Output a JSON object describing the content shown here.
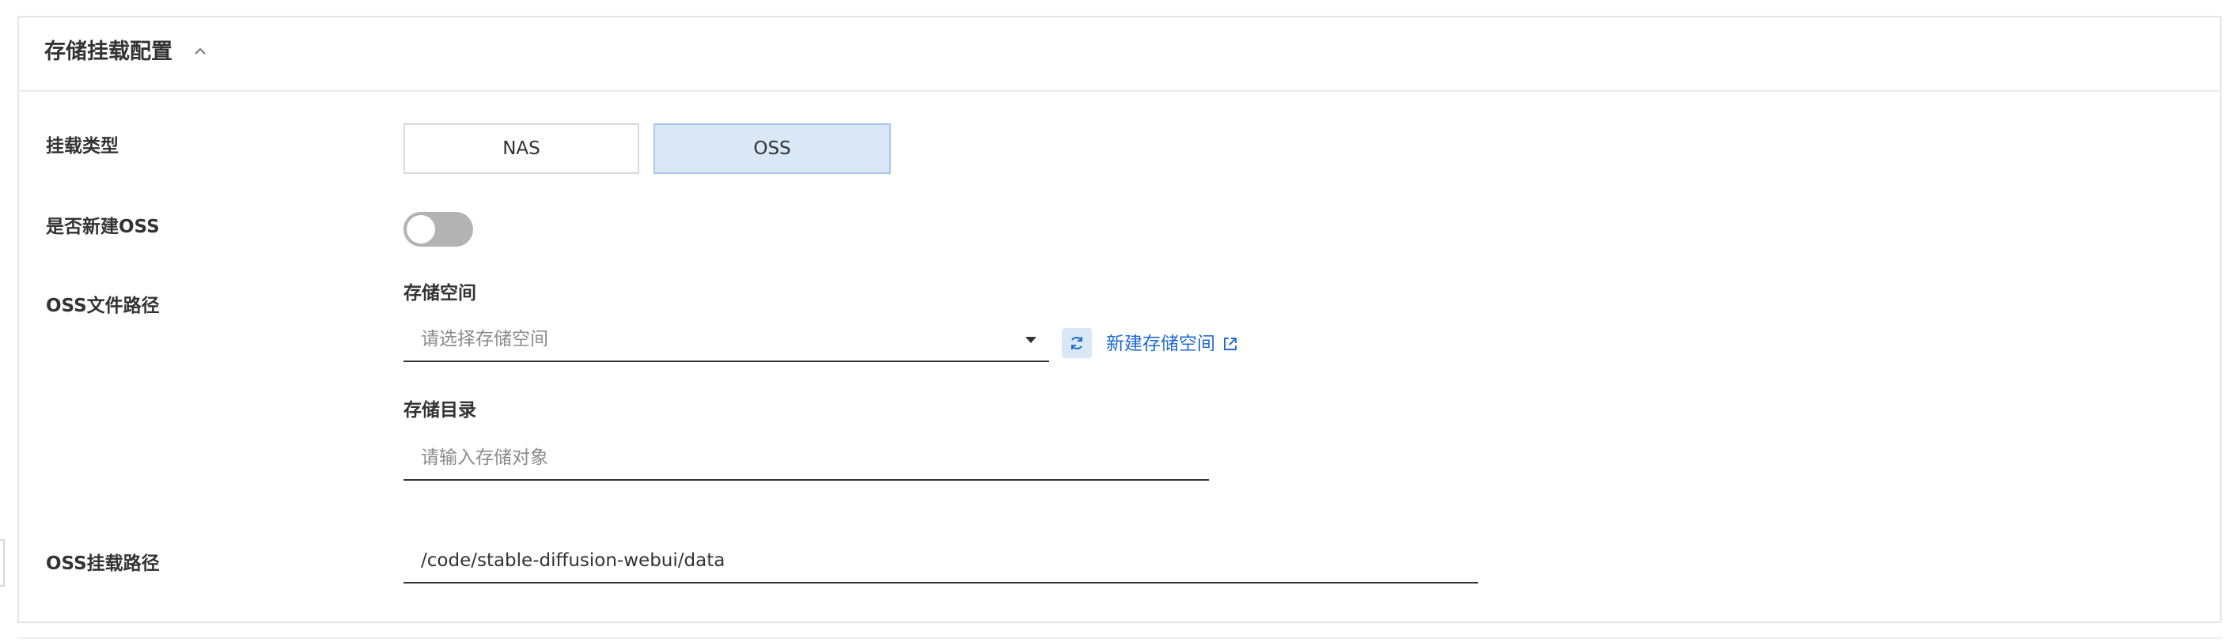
{
  "panel": {
    "title": "存储挂载配置",
    "collapse_icon": "chevron-up-icon"
  },
  "mount_type": {
    "label": "挂载类型",
    "options": [
      "NAS",
      "OSS"
    ],
    "selected": "OSS"
  },
  "create_oss": {
    "label": "是否新建OSS",
    "enabled": false
  },
  "oss_path": {
    "label": "OSS文件路径",
    "bucket": {
      "label": "存储空间",
      "placeholder": "请选择存储空间",
      "refresh_icon": "refresh-icon",
      "create_link": "新建存储空间",
      "external_icon": "external-link-icon"
    },
    "directory": {
      "label": "存储目录",
      "placeholder": "请输入存储对象"
    }
  },
  "oss_mount_path": {
    "label": "OSS挂载路径",
    "value": "/code/stable-diffusion-webui/data"
  },
  "colors": {
    "accent": "#1f6bcf",
    "selected_bg": "#d9e7f7",
    "toggle_off": "#b3b3b3"
  }
}
